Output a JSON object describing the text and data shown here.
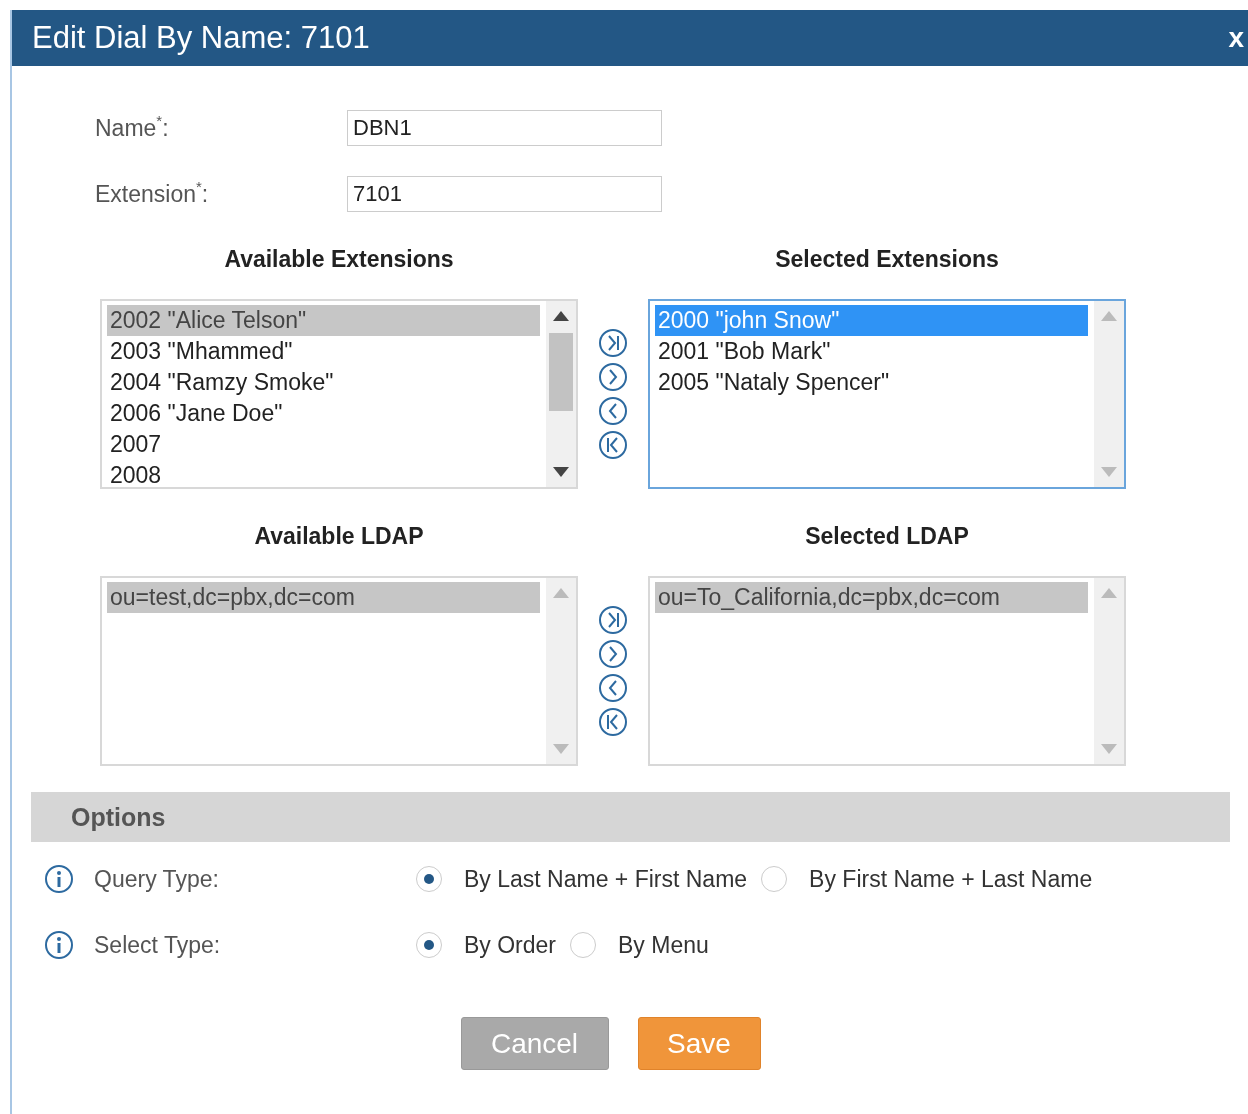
{
  "dialog": {
    "title": "Edit Dial By Name: 7101",
    "close": "x"
  },
  "fields": [
    {
      "label": "Name$^{*}$:",
      "value": "DBN1"
    },
    {
      "label": "Extension$^{*}$:",
      "value": "7101"
    }
  ],
  "transfers": [
    {
      "available": {
        "title": "Available Extensions",
        "focused": false,
        "scrollable": true,
        "items": [
          {
            "text": "2002 \"Alice Telson\"",
            "selected": true
          },
          {
            "text": "2003 \"Mhammed\"",
            "selected": false
          },
          {
            "text": "2004 \"Ramzy Smoke\"",
            "selected": false
          },
          {
            "text": "2006 \"Jane Doe\"",
            "selected": false
          },
          {
            "text": "2007",
            "selected": false
          },
          {
            "text": "2008",
            "selected": false
          }
        ]
      },
      "selected_list": {
        "title": "Selected Extensions",
        "focused": true,
        "scrollable": false,
        "items": [
          {
            "text": "2000 \"john Snow\"",
            "selected": true
          },
          {
            "text": "2001 \"Bob Mark\"",
            "selected": false
          },
          {
            "text": "2005 \"Nataly Spencer\"",
            "selected": false
          }
        ]
      }
    },
    {
      "available": {
        "title": "Available LDAP",
        "focused": false,
        "scrollable": false,
        "items": [
          {
            "text": "ou=test,dc=pbx,dc=com",
            "selected": true
          }
        ]
      },
      "selected_list": {
        "title": "Selected LDAP",
        "focused": false,
        "scrollable": false,
        "items": [
          {
            "text": "ou=To_California,dc=pbx,dc=com",
            "selected": true
          }
        ]
      }
    }
  ],
  "options": {
    "title": "Options",
    "rows": [
      {
        "label": "Query Type:",
        "choices": [
          {
            "label": "By Last Name + First Name",
            "selected": true
          },
          {
            "label": "By First Name + Last Name",
            "selected": false
          }
        ]
      },
      {
        "label": "Select Type:",
        "choices": [
          {
            "label": "By Order",
            "selected": true
          },
          {
            "label": "By Menu",
            "selected": false
          }
        ]
      }
    ]
  },
  "buttons": [
    {
      "label": "Cancel",
      "kind": "cancel"
    },
    {
      "label": "Save",
      "kind": "save"
    }
  ]
}
